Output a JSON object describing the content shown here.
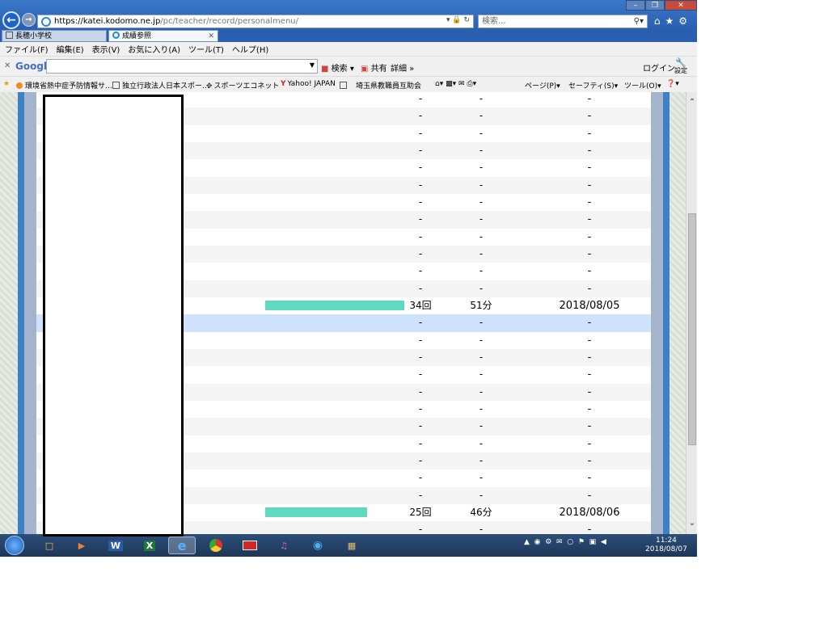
{
  "browser": {
    "url_host": "https://katei.kodomo.ne.jp",
    "url_path": "/pc/teacher/record/personalmenu/",
    "search_placeholder": "検索...",
    "tabs": [
      {
        "label": "長穂小学校"
      },
      {
        "label": "成績参照"
      }
    ],
    "menu": [
      "ファイル(F)",
      "編集(E)",
      "表示(V)",
      "お気に入り(A)",
      "ツール(T)",
      "ヘルプ(H)"
    ],
    "google_toolbar": {
      "logo": "Google",
      "search_label": "検索",
      "share_label": "共有",
      "more_label": "詳細",
      "login_label": "ログイン",
      "settings_label": "設定"
    },
    "favorites": [
      "環境省熱中症予防情報サ…",
      "独立行政法人日本スポー…",
      "スポーツエコネット",
      "Yahoo! JAPAN",
      "埼玉県教職員互助会"
    ],
    "command_bar": {
      "page_label": "ページ(P)",
      "safety_label": "セーフティ(S)",
      "tools_label": "ツール(O)"
    }
  },
  "table": {
    "rows": [
      {
        "times": "-",
        "minutes": "-",
        "date": "-"
      },
      {
        "times": "-",
        "minutes": "-",
        "date": "-"
      },
      {
        "times": "-",
        "minutes": "-",
        "date": "-"
      },
      {
        "times": "-",
        "minutes": "-",
        "date": "-"
      },
      {
        "times": "-",
        "minutes": "-",
        "date": "-"
      },
      {
        "times": "-",
        "minutes": "-",
        "date": "-"
      },
      {
        "times": "-",
        "minutes": "-",
        "date": "-"
      },
      {
        "times": "-",
        "minutes": "-",
        "date": "-"
      },
      {
        "times": "-",
        "minutes": "-",
        "date": "-"
      },
      {
        "times": "-",
        "minutes": "-",
        "date": "-"
      },
      {
        "times": "-",
        "minutes": "-",
        "date": "-"
      },
      {
        "times": "-",
        "minutes": "-",
        "date": "-"
      },
      {
        "times": "34回",
        "minutes": "51分",
        "date": "2018/08/05",
        "bar": 34
      },
      {
        "times": "-",
        "minutes": "-",
        "date": "-",
        "selected": true
      },
      {
        "times": "-",
        "minutes": "-",
        "date": "-"
      },
      {
        "times": "-",
        "minutes": "-",
        "date": "-"
      },
      {
        "times": "-",
        "minutes": "-",
        "date": "-"
      },
      {
        "times": "-",
        "minutes": "-",
        "date": "-"
      },
      {
        "times": "-",
        "minutes": "-",
        "date": "-"
      },
      {
        "times": "-",
        "minutes": "-",
        "date": "-"
      },
      {
        "times": "-",
        "minutes": "-",
        "date": "-"
      },
      {
        "times": "-",
        "minutes": "-",
        "date": "-"
      },
      {
        "times": "-",
        "minutes": "-",
        "date": "-"
      },
      {
        "times": "-",
        "minutes": "-",
        "date": "-"
      },
      {
        "times": "25回",
        "minutes": "46分",
        "date": "2018/08/06",
        "bar": 25
      },
      {
        "times": "-",
        "minutes": "-",
        "date": "-"
      }
    ],
    "bar_color": "#5fd9bf",
    "bar_max": 34
  },
  "taskbar": {
    "clock_time": "11:24",
    "clock_date": "2018/08/07"
  }
}
